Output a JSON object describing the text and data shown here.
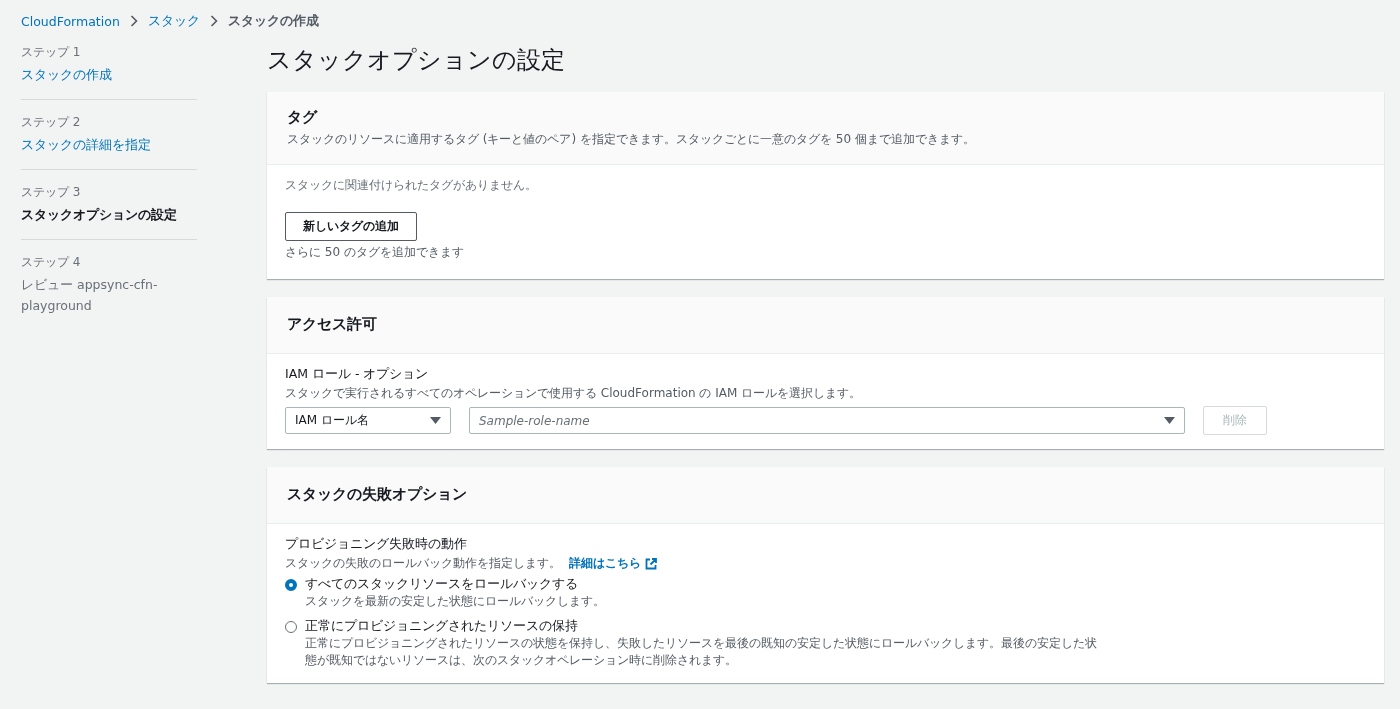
{
  "breadcrumb": [
    {
      "label": "CloudFormation",
      "kind": "link"
    },
    {
      "label": "スタック",
      "kind": "link"
    },
    {
      "label": "スタックの作成",
      "kind": "current"
    }
  ],
  "steps": [
    {
      "step": "ステップ 1",
      "name": "スタックの作成",
      "kind": "done"
    },
    {
      "step": "ステップ 2",
      "name": "スタックの詳細を指定",
      "kind": "done"
    },
    {
      "step": "ステップ 3",
      "name": "スタックオプションの設定",
      "kind": "current"
    },
    {
      "step": "ステップ 4",
      "name": "レビュー appsync-cfn-playground",
      "kind": "pending"
    }
  ],
  "page_title": "スタックオプションの設定",
  "tags_panel": {
    "title": "タグ",
    "description": "スタックのリソースに適用するタグ (キーと値のペア) を指定できます。スタックごとに一意のタグを 50 個まで追加できます。",
    "empty_text": "スタックに関連付けられたタグがありません。",
    "add_button": "新しいタグの追加",
    "hint": "さらに 50 のタグを追加できます"
  },
  "permissions_panel": {
    "title": "アクセス許可",
    "field_label": "IAM ロール - オプション",
    "field_description": "スタックで実行されるすべてのオペレーションで使用する CloudFormation の IAM ロールを選択します。",
    "type_select": "IAM ロール名",
    "role_placeholder": "Sample-role-name",
    "remove_button": {
      "label": "削除",
      "disabled": true
    }
  },
  "failure_panel": {
    "title": "スタックの失敗オプション",
    "field_label": "プロビジョニング失敗時の動作",
    "field_description": "スタックの失敗のロールバック動作を指定します。",
    "info_link": "詳細はこちら",
    "options": [
      {
        "label": "すべてのスタックリソースをロールバックする",
        "description": "スタックを最新の安定した状態にロールバックします。",
        "selected": true
      },
      {
        "label": "正常にプロビジョニングされたリソースの保持",
        "description": "正常にプロビジョニングされたリソースの状態を保持し、失敗したリソースを最後の既知の安定した状態にロールバックします。最後の安定した状態が既知ではないリソースは、次のスタックオペレーション時に削除されます。",
        "selected": false
      }
    ]
  }
}
